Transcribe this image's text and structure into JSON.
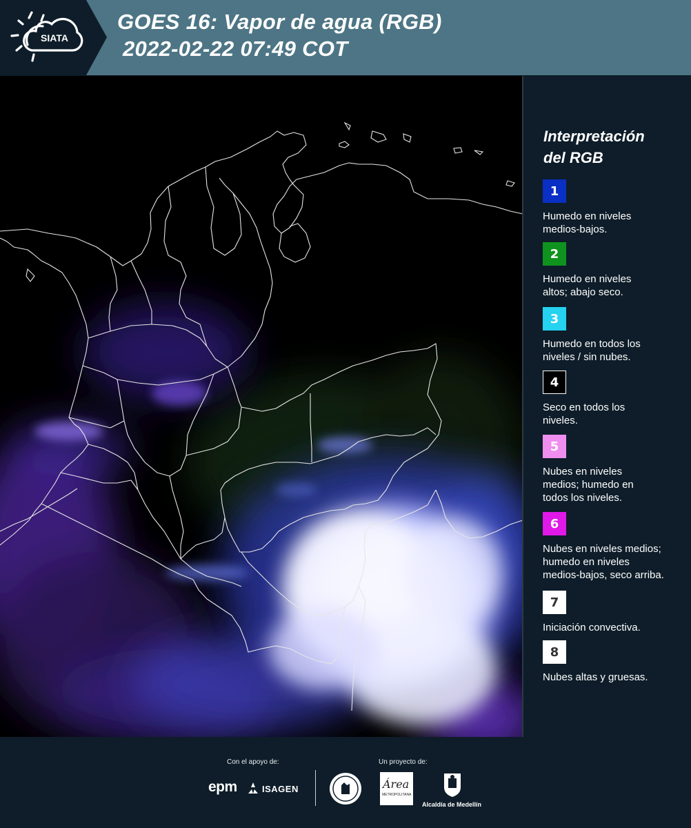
{
  "header": {
    "logo_text": "SIATA",
    "title_line1": "GOES 16: Vapor de agua (RGB)",
    "title_line2": "2022-02-22 07:49 COT"
  },
  "legend": {
    "title_line1": "Interpretación",
    "title_line2": "del RGB",
    "items": [
      {
        "number": "1",
        "color": "#0a2fc4",
        "text_color": "#ffffff",
        "border": "#0a2fc4",
        "lines": [
          "Humedo en niveles",
          "medios-bajos."
        ]
      },
      {
        "number": "2",
        "color": "#10931e",
        "text_color": "#ffffff",
        "border": "#10931e",
        "lines": [
          "Humedo en niveles",
          "altos; abajo seco."
        ]
      },
      {
        "number": "3",
        "color": "#25d2f0",
        "text_color": "#ffffff",
        "border": "#25d2f0",
        "lines": [
          "Humedo en todos los",
          "niveles / sin nubes."
        ]
      },
      {
        "number": "4",
        "color": "#000000",
        "text_color": "#ffffff",
        "border": "#ffffff",
        "lines": [
          "Seco en todos los",
          "niveles."
        ]
      },
      {
        "number": "5",
        "color": "#f08ef0",
        "text_color": "#ffffff",
        "border": "#f08ef0",
        "lines": [
          "Nubes en niveles",
          "medios; humedo en",
          "todos los niveles."
        ]
      },
      {
        "number": "6",
        "color": "#e018e8",
        "text_color": "#ffffff",
        "border": "#e018e8",
        "lines": [
          "Nubes en niveles medios;",
          "humedo en niveles",
          "medios-bajos, seco arriba."
        ]
      },
      {
        "number": "7",
        "color": "#ffffff",
        "text_color": "#333333",
        "border": "#ffffff",
        "lines": [
          "Iniciación convectiva."
        ]
      },
      {
        "number": "8",
        "color": "#ffffff",
        "text_color": "#333333",
        "border": "#ffffff",
        "lines": [
          "Nubes altas y gruesas."
        ]
      }
    ]
  },
  "footer": {
    "support_caption": "Con el apoyo de:",
    "project_caption": "Un proyecto de:",
    "epm_logo": "epm",
    "isagen_logo": "ISAGEN",
    "area_logo": "Área",
    "area_subtitle": "METROPOLITANA",
    "alcaldia_logo": "Alcaldía de Medellín"
  },
  "colors": {
    "header_bg": "#4d7585",
    "logo_bg": "#0e1d29",
    "page_bg": "#0e1d29"
  },
  "icons": {
    "logo": "sun-cloud-icon",
    "antioquia_seal": "seal-icon",
    "alcaldia_seal": "shield-icon"
  }
}
